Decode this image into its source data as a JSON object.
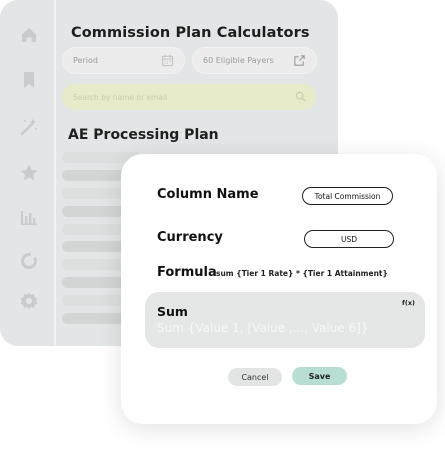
{
  "app": {
    "title": "Commission Plan Calculators",
    "period_placeholder": "Period",
    "payers_label": "60 Eligible Payers",
    "search_placeholder": "Search by name or email",
    "plan_title": "AE Processing Plan"
  },
  "sidebar": {
    "icons": [
      "home-icon",
      "bookmark-icon",
      "magic-wand-icon",
      "star-icon",
      "bar-chart-icon",
      "circle-sync-icon",
      "gear-icon"
    ]
  },
  "modal": {
    "column_name_label": "Column Name",
    "column_name_value": "Total Commission",
    "currency_label": "Currency",
    "currency_value": "USD",
    "formula_label": "Formula",
    "formula_value": "sum {Tier 1 Rate} * {Tier 1 Attainment}",
    "function_title": "Sum",
    "function_syntax": "Sum {Value 1, [Value ,..., Value 6]}",
    "fx_label": "f(x)",
    "cancel_label": "Cancel",
    "save_label": "Save"
  },
  "colors": {
    "app_bg": "#e3e6e6",
    "search_bg": "#e8ebc9",
    "save_bg": "#b7ddd4",
    "function_box_bg": "#e5e7e7"
  }
}
